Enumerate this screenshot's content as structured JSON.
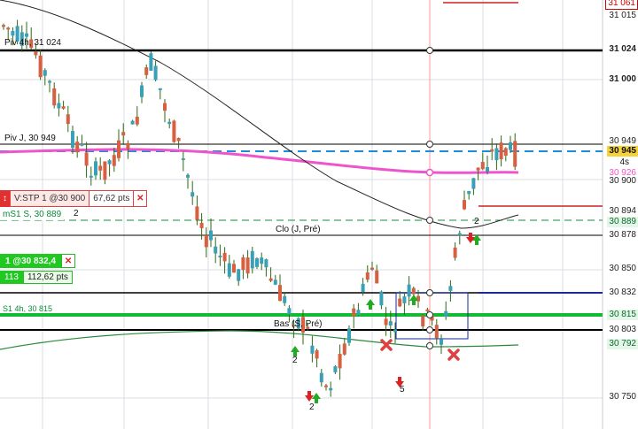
{
  "axis": {
    "labels": [
      "31 061",
      "31 015",
      "31 024",
      "31 000",
      "30 949",
      "30 945",
      "4s",
      "30 926",
      "30 900",
      "30 894",
      "30 889",
      "30 878",
      "30 850",
      "30 832",
      "30 815",
      "30 803",
      "30 792",
      "30 750"
    ]
  },
  "levels": {
    "piv_4h": "Piv 4h, 31 024",
    "piv_j": "Piv J, 30 949",
    "ms1": "mS1 S, 30 889",
    "clo": "Clo (J, Pré)",
    "bas": "Bas (S, Pré)",
    "s1_4h": "S1 4h, 30 815"
  },
  "orders": {
    "stop": {
      "label": "V:STP  1 @30 900",
      "pts": "67,62 pts",
      "count": "2"
    },
    "position": {
      "label": "1 @30 832,4",
      "qty": "113",
      "pts": "112,62 pts"
    }
  },
  "markers": [
    "2",
    "2",
    "2",
    "2",
    "5"
  ],
  "colors": {
    "up_candle": "#3aa0b8",
    "down_candle": "#d86040",
    "wick": "#2e6a12",
    "moving_avg_pink": "#ee55cc",
    "dashed_blue": "#1b8fd6",
    "green_level": "#11bb33",
    "red_level": "#cc2222",
    "navy_level": "#1a2a9a"
  },
  "icons": [
    "close-icon",
    "arrow-up-icon",
    "arrow-down-icon",
    "cross-marker-icon",
    "sort-arrows-icon"
  ]
}
